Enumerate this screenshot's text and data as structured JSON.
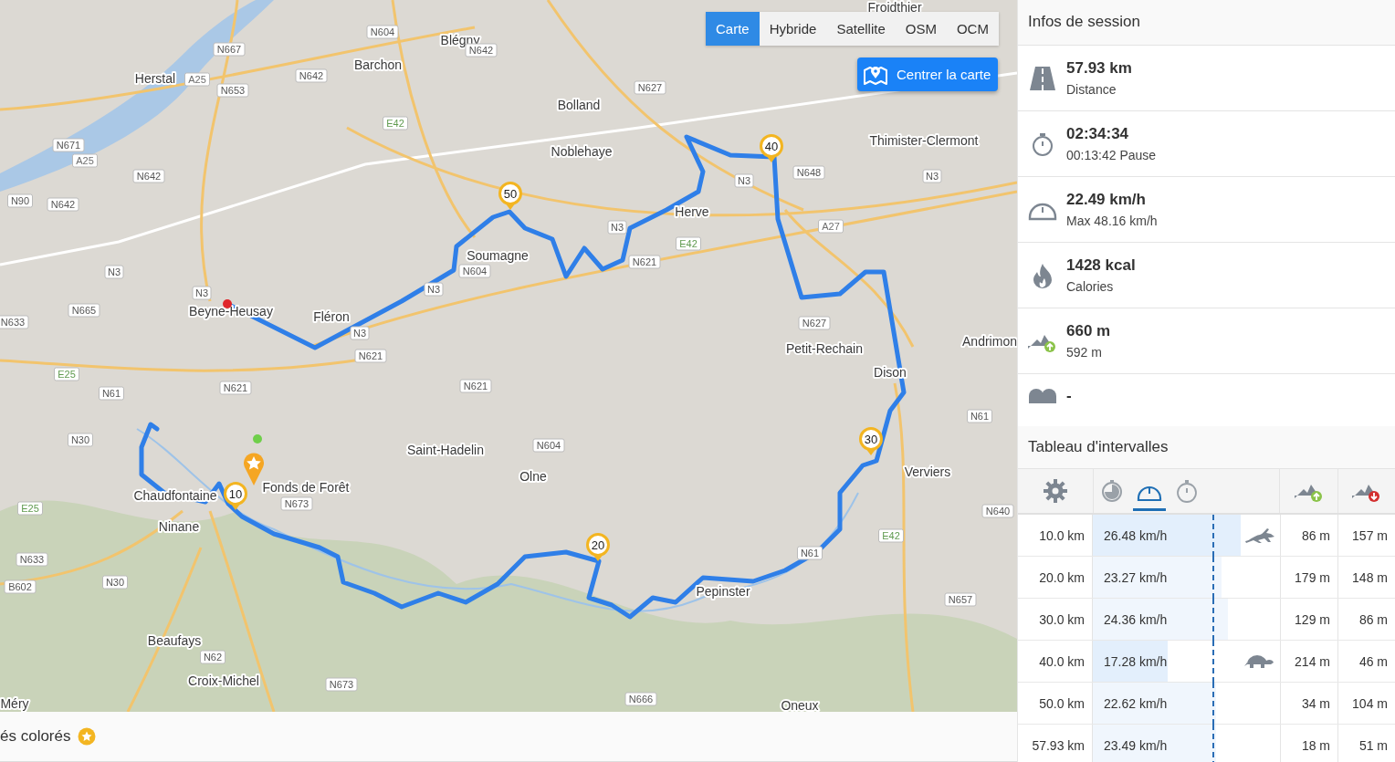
{
  "map": {
    "layers": [
      {
        "label": "Carte",
        "selected": true
      },
      {
        "label": "Hybride",
        "selected": false
      },
      {
        "label": "Satellite",
        "selected": false
      },
      {
        "label": "OSM",
        "selected": false
      },
      {
        "label": "OCM",
        "selected": false
      }
    ],
    "center_button": "Centrer la carte",
    "places": [
      "Froidthier",
      "Blégny",
      "Barchon",
      "Herstal",
      "Bolland",
      "Noblehaye",
      "Thimister-Clermont",
      "Herve",
      "Soumagne",
      "Fléron",
      "Beyne-Heusay",
      "Petit-Rechain",
      "Dison",
      "Saint-Hadelin",
      "Olne",
      "Verviers",
      "Chaudfontaine",
      "Fonds de Forêt",
      "Ninane",
      "Pepinster",
      "Beaufays",
      "Croix-Michel",
      "Méry",
      "Oneux",
      "Andrimon"
    ],
    "roads": [
      "N604",
      "N642",
      "N667",
      "A25",
      "N653",
      "N642",
      "N627",
      "E42",
      "N671",
      "A25",
      "N642",
      "N90",
      "N642",
      "N3",
      "N3",
      "N665",
      "N633",
      "N604",
      "N3",
      "N3",
      "N621",
      "N621",
      "N621",
      "N621",
      "N3",
      "E42",
      "N3",
      "N648",
      "N3",
      "A27",
      "N627",
      "E25",
      "N61",
      "N30",
      "N604",
      "N61",
      "E25",
      "N673",
      "N633",
      "N30",
      "B602",
      "N62",
      "N673",
      "N666",
      "N657",
      "N640",
      "E42",
      "N61"
    ],
    "km_markers": [
      "10",
      "20",
      "30",
      "40",
      "50"
    ]
  },
  "legend": {
    "text": "és colorés"
  },
  "session": {
    "title": "Infos de session",
    "items": [
      {
        "kind": "distance",
        "value": "57.93 km",
        "label": "Distance"
      },
      {
        "kind": "duration",
        "value": "02:34:34",
        "label": "00:13:42 Pause"
      },
      {
        "kind": "speed",
        "value": "22.49 km/h",
        "label": "Max 48.16 km/h"
      },
      {
        "kind": "calories",
        "value": "1428 kcal",
        "label": "Calories"
      },
      {
        "kind": "elevation",
        "value": "660 m",
        "label": "592 m"
      },
      {
        "kind": "other",
        "value": "-"
      }
    ]
  },
  "intervals": {
    "title": "Tableau d'intervalles",
    "metric_tabs": [
      {
        "kind": "pace",
        "selected": false
      },
      {
        "kind": "speed",
        "selected": true
      },
      {
        "kind": "time",
        "selected": false
      }
    ],
    "rows": [
      {
        "distance": "10.0 km",
        "speed": "26.48 km/h",
        "level": 0.79,
        "highlight": true,
        "fastest": true,
        "slowest": false,
        "ascent": "86 m",
        "descent": "157 m"
      },
      {
        "distance": "20.0 km",
        "speed": "23.27 km/h",
        "level": 0.69,
        "highlight": false,
        "fastest": false,
        "slowest": false,
        "ascent": "179 m",
        "descent": "148 m"
      },
      {
        "distance": "30.0 km",
        "speed": "24.36 km/h",
        "level": 0.72,
        "highlight": false,
        "fastest": false,
        "slowest": false,
        "ascent": "129 m",
        "descent": "86 m"
      },
      {
        "distance": "40.0 km",
        "speed": "17.28 km/h",
        "level": 0.4,
        "highlight": true,
        "fastest": false,
        "slowest": true,
        "ascent": "214 m",
        "descent": "46 m"
      },
      {
        "distance": "50.0 km",
        "speed": "22.62 km/h",
        "level": 0.66,
        "highlight": false,
        "fastest": false,
        "slowest": false,
        "ascent": "34 m",
        "descent": "104 m"
      },
      {
        "distance": "57.93 km",
        "speed": "23.49 km/h",
        "level": 0.66,
        "highlight": false,
        "fastest": false,
        "slowest": false,
        "ascent": "18 m",
        "descent": "51 m"
      }
    ]
  }
}
